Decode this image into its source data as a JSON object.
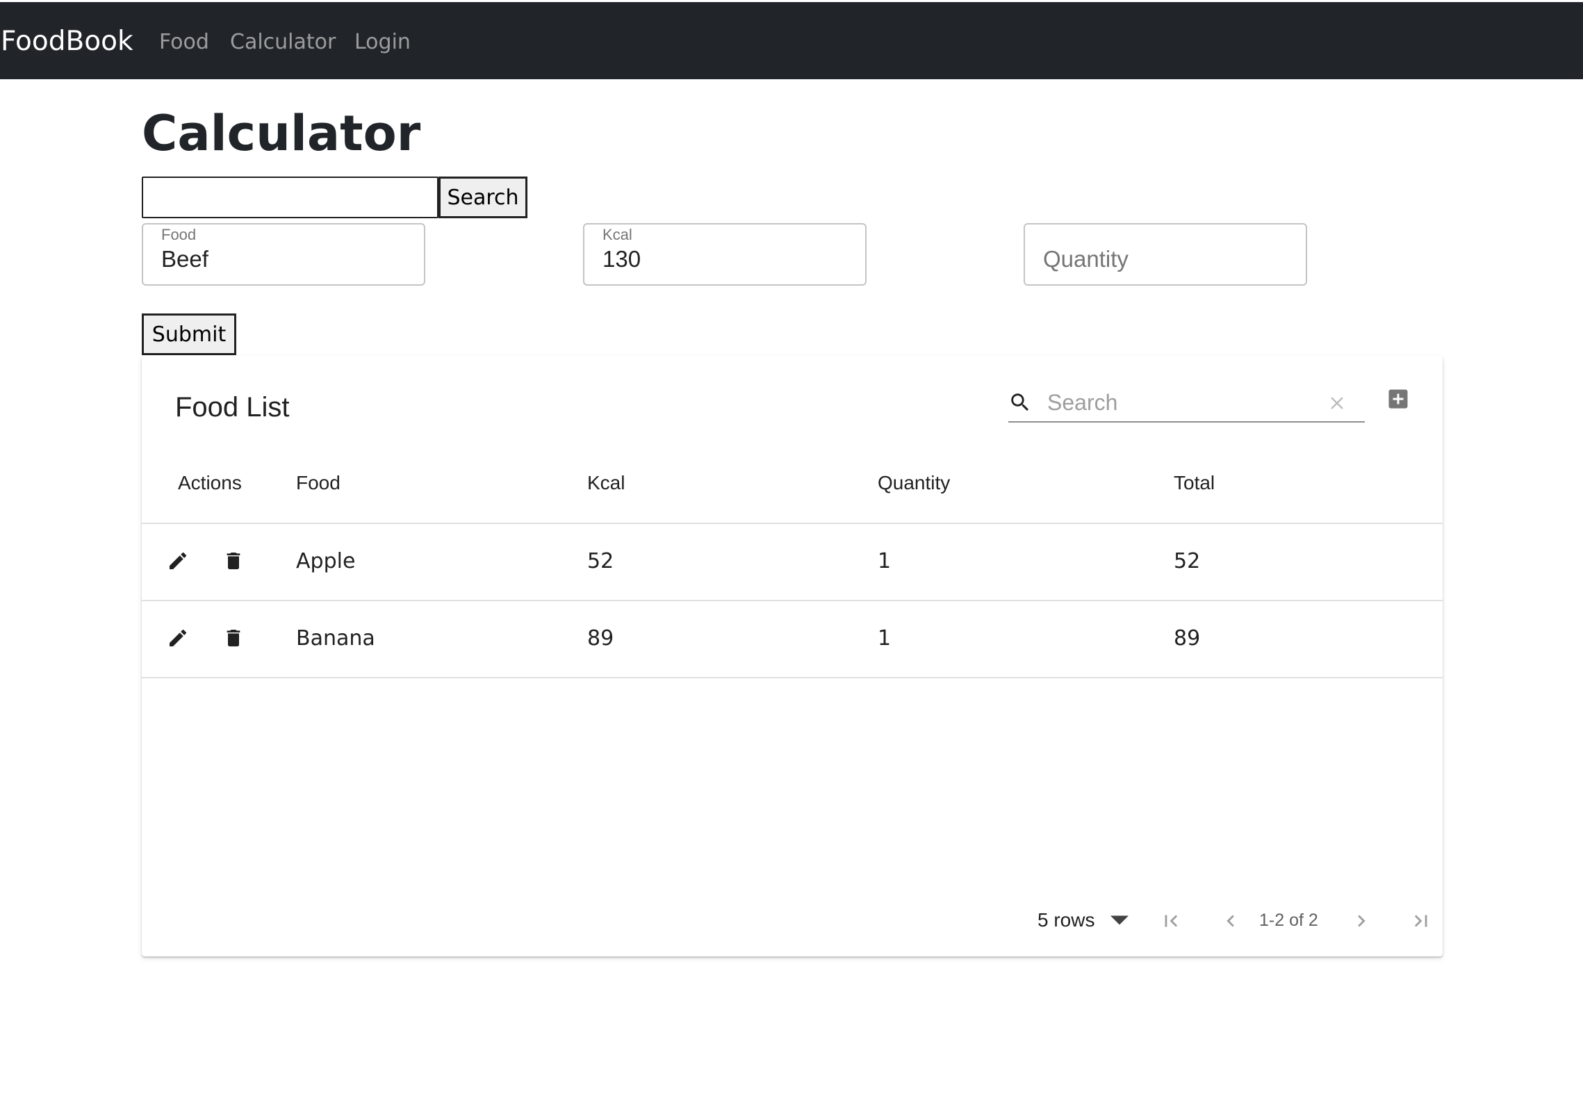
{
  "navbar": {
    "brand": "FoodBook",
    "links": [
      "Food",
      "Calculator",
      "Login"
    ]
  },
  "page": {
    "title": "Calculator",
    "search_value": "",
    "search_button": "Search"
  },
  "form": {
    "food": {
      "label": "Food",
      "value": "Beef"
    },
    "kcal": {
      "label": "Kcal",
      "value": "130"
    },
    "quantity": {
      "placeholder": "Quantity",
      "value": ""
    },
    "submit_label": "Submit"
  },
  "table": {
    "title": "Food List",
    "search_placeholder": "Search",
    "search_value": "",
    "columns": [
      "Actions",
      "Food",
      "Kcal",
      "Quantity",
      "Total"
    ],
    "rows": [
      {
        "food": "Apple",
        "kcal": "52",
        "quantity": "1",
        "total": "52"
      },
      {
        "food": "Banana",
        "kcal": "89",
        "quantity": "1",
        "total": "89"
      }
    ],
    "pagination": {
      "rows_per_page": "5 rows",
      "range": "1-2 of 2"
    },
    "icons": {
      "search": "search-icon",
      "clear": "close-icon",
      "add": "add-box-icon",
      "edit": "pencil-icon",
      "delete": "trash-icon",
      "first": "first-page-icon",
      "prev": "chevron-left-icon",
      "next": "chevron-right-icon",
      "last": "last-page-icon",
      "dropdown": "arrow-drop-down-icon"
    }
  },
  "colors": {
    "navbar_bg": "#212529",
    "nav_link": "rgba(255,255,255,0.55)",
    "brand": "#ffffff",
    "icon": "#212121",
    "disabled_icon": "#9e9e9e",
    "add_icon": "#757575"
  }
}
